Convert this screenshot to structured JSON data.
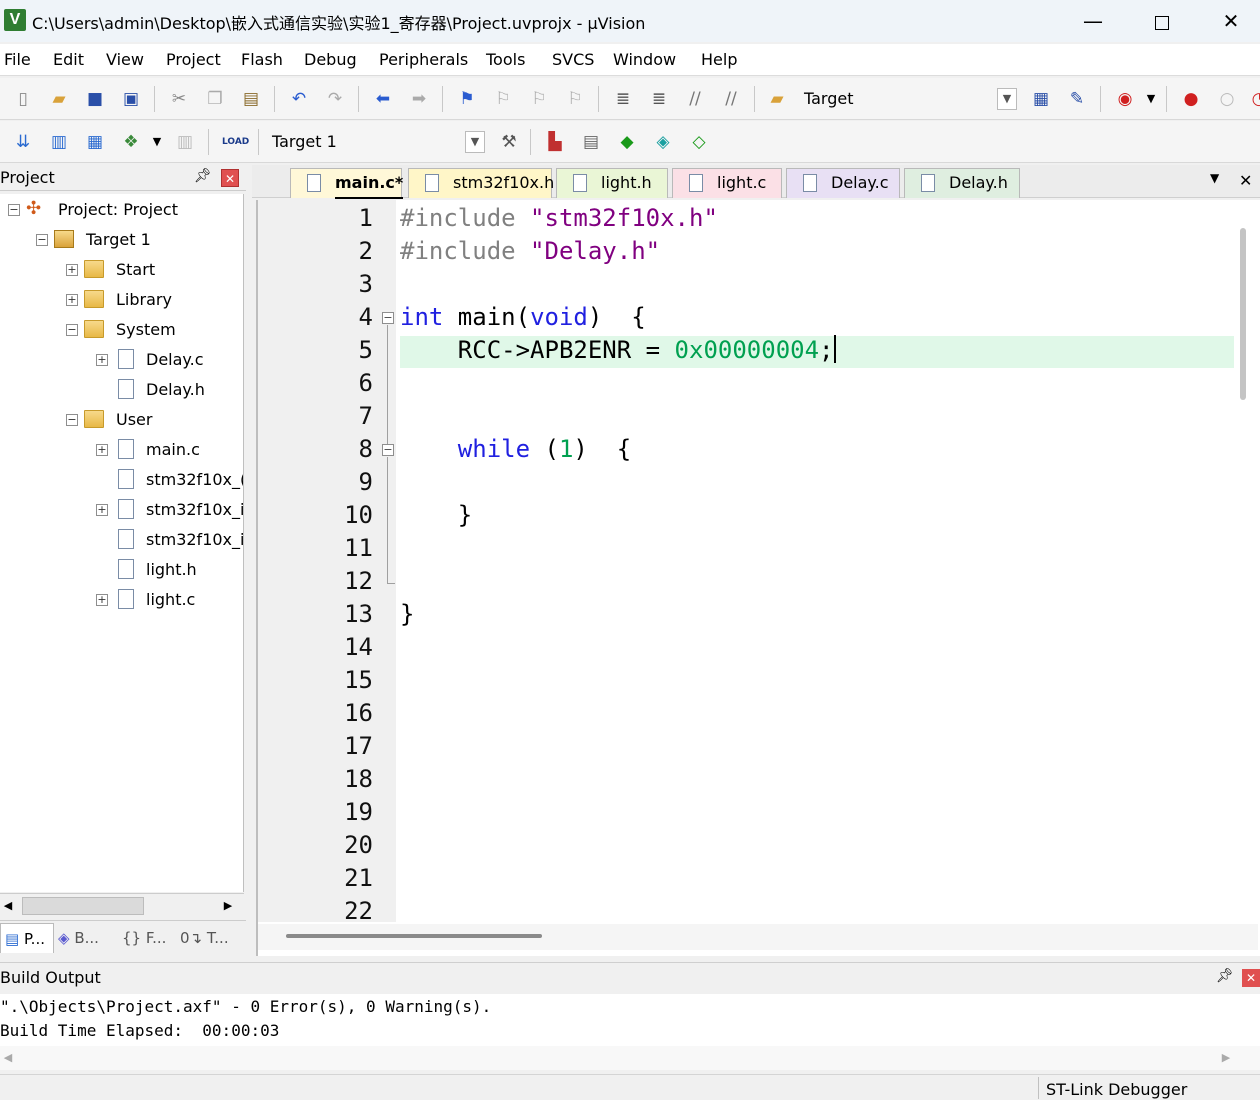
{
  "window": {
    "title": "C:\\Users\\admin\\Desktop\\嵌入式通信实验\\实验1_寄存器\\Project.uvprojx - µVision",
    "app_icon_letter": "V",
    "minimize": "—",
    "close": "✕"
  },
  "menu": [
    "File",
    "Edit",
    "View",
    "Project",
    "Flash",
    "Debug",
    "Peripherals",
    "Tools",
    "SVCS",
    "Window",
    "Help"
  ],
  "toolbar1": {
    "target_combo": "Target"
  },
  "toolbar2": {
    "target_combo": "Target 1",
    "load_label": "LOAD"
  },
  "project_panel": {
    "title": "Project",
    "tree": [
      {
        "label": "Project: Project",
        "icon": "project-icon",
        "level": 0,
        "expander": "−"
      },
      {
        "label": "Target 1",
        "icon": "target-icon",
        "level": 1,
        "expander": "−"
      },
      {
        "label": "Start",
        "icon": "folder-icon",
        "level": 2,
        "expander": "+"
      },
      {
        "label": "Library",
        "icon": "folder-icon",
        "level": 2,
        "expander": "+"
      },
      {
        "label": "System",
        "icon": "folder-icon",
        "level": 2,
        "expander": "−"
      },
      {
        "label": "Delay.c",
        "icon": "file-icon",
        "level": 3,
        "expander": "+"
      },
      {
        "label": "Delay.h",
        "icon": "file-icon",
        "level": 3,
        "expander": ""
      },
      {
        "label": "User",
        "icon": "folder-icon",
        "level": 2,
        "expander": "−"
      },
      {
        "label": "main.c",
        "icon": "file-icon",
        "level": 3,
        "expander": "+"
      },
      {
        "label": "stm32f10x_(",
        "icon": "file-icon",
        "level": 3,
        "expander": ""
      },
      {
        "label": "stm32f10x_i",
        "icon": "file-icon",
        "level": 3,
        "expander": "+"
      },
      {
        "label": "stm32f10x_i",
        "icon": "file-icon",
        "level": 3,
        "expander": ""
      },
      {
        "label": "light.h",
        "icon": "file-icon",
        "level": 3,
        "expander": ""
      },
      {
        "label": "light.c",
        "icon": "file-icon",
        "level": 3,
        "expander": "+"
      }
    ],
    "bottom_tabs": [
      "P...",
      "B...",
      "F...",
      "T..."
    ]
  },
  "editor_tabs": [
    {
      "label": "main.c*",
      "color": "#fff8d8",
      "active": true
    },
    {
      "label": "stm32f10x.h",
      "color": "#fff6c8",
      "active": false
    },
    {
      "label": "light.h",
      "color": "#eaf6d6",
      "active": false
    },
    {
      "label": "light.c",
      "color": "#fbe0e6",
      "active": false
    },
    {
      "label": "Delay.c",
      "color": "#e8e0f4",
      "active": false
    },
    {
      "label": "Delay.h",
      "color": "#dfeee0",
      "active": false
    }
  ],
  "editor": {
    "line_numbers": [
      "1",
      "2",
      "3",
      "4",
      "5",
      "6",
      "7",
      "8",
      "9",
      "10",
      "11",
      "12",
      "13",
      "14",
      "15",
      "16",
      "17",
      "18",
      "19",
      "20",
      "21",
      "22"
    ],
    "code": {
      "l1_pp": "#include",
      "l1_str": "\"stm32f10x.h\"",
      "l2_pp": "#include",
      "l2_str": "\"Delay.h\"",
      "l4_kw1": "int",
      "l4_mid": " main(",
      "l4_kw2": "void",
      "l4_end": ")  {",
      "l5_plain": "    RCC->APB2ENR = ",
      "l5_num": "0x00000004",
      "l5_end": ";",
      "l8_kw": "    while",
      "l8_mid": " (",
      "l8_num": "1",
      "l8_end": ")  {",
      "l10": "    }",
      "l13": "}"
    }
  },
  "build_output": {
    "title": "Build Output",
    "lines": [
      "\".\\Objects\\Project.axf\" - 0 Error(s), 0 Warning(s).",
      "Build Time Elapsed:  00:00:03"
    ]
  },
  "status": {
    "debugger": "ST-Link Debugger"
  }
}
